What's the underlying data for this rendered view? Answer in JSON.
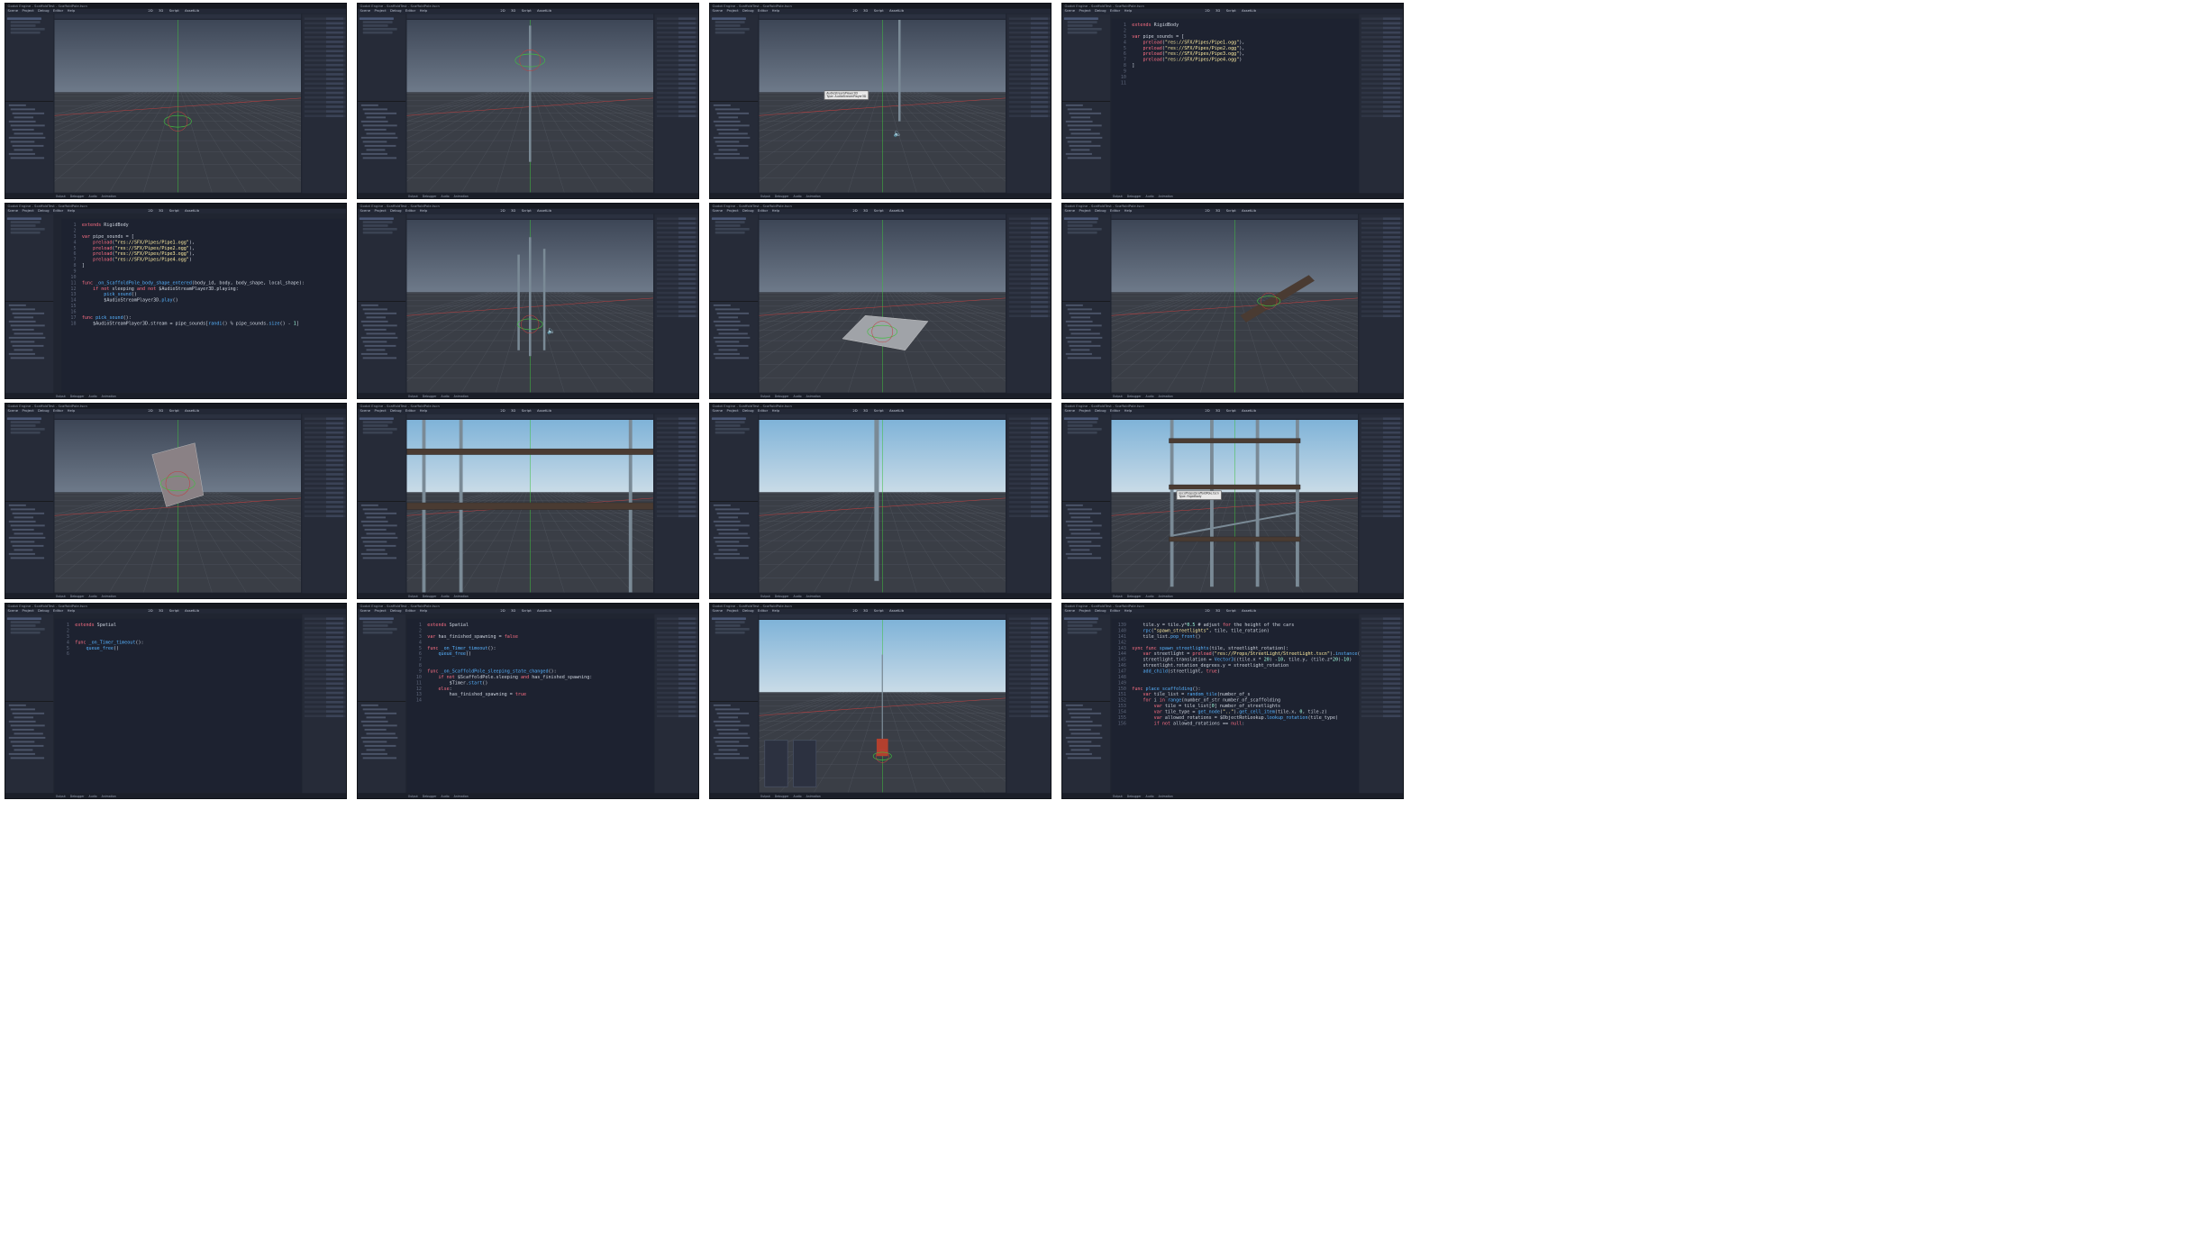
{
  "window": {
    "title": "Godot Engine - ScaffoldTest - ScaffoldPole.tscn",
    "menu": [
      "Scene",
      "Project",
      "Debug",
      "Editor",
      "Help"
    ],
    "workspaces": [
      "2D",
      "3D",
      "Script",
      "AssetLib"
    ],
    "bottom_tabs": [
      "Output",
      "Debugger",
      "Audio",
      "Animation"
    ]
  },
  "panels": [
    {
      "type": "viewport",
      "variant": "gizmo-ring"
    },
    {
      "type": "viewport",
      "variant": "pole-gizmo"
    },
    {
      "type": "viewport",
      "variant": "pole-speaker",
      "tooltip": "AudioStreamPlayer3D\nType: AudioStreamPlayer3D"
    },
    {
      "type": "code",
      "start": 1,
      "lines": [
        "extends RigidBody",
        "",
        "var pipe_sounds = [",
        "\tpreload(\"res://SFX/Pipes/Pipe1.ogg\"),",
        "\tpreload(\"res://SFX/Pipes/Pipe2.ogg\"),",
        "\tpreload(\"res://SFX/Pipes/Pipe3.ogg\"),",
        "\tpreload(\"res://SFX/Pipes/Pipe4.ogg\")",
        "]",
        "",
        "",
        ""
      ]
    },
    {
      "type": "code",
      "start": 1,
      "wide": true,
      "lines": [
        "extends RigidBody",
        "",
        "var pipe_sounds = [",
        "\tpreload(\"res://SFX/Pipes/Pipe1.ogg\"),",
        "\tpreload(\"res://SFX/Pipes/Pipe2.ogg\"),",
        "\tpreload(\"res://SFX/Pipes/Pipe3.ogg\"),",
        "\tpreload(\"res://SFX/Pipes/Pipe4.ogg\")",
        "]",
        "",
        "",
        "func _on_ScaffoldPole_body_shape_entered(body_id, body, body_shape, local_shape):",
        "\tif not sleeping and not $AudioStreamPlayer3D.playing:",
        "\t\tpick_sound()",
        "\t\t$AudioStreamPlayer3D.play()",
        "",
        "",
        "func pick_sound():",
        "\t$AudioStreamPlayer3D.stream = pipe_sounds[randi() % pipe_sounds.size() - 1]"
      ]
    },
    {
      "type": "viewport",
      "variant": "three-poles"
    },
    {
      "type": "viewport",
      "variant": "plank"
    },
    {
      "type": "viewport",
      "variant": "plank-angled"
    },
    {
      "type": "viewport",
      "variant": "cube"
    },
    {
      "type": "viewport",
      "variant": "shelves",
      "sky": "bright"
    },
    {
      "type": "viewport",
      "variant": "single-pole",
      "sky": "bright"
    },
    {
      "type": "viewport",
      "variant": "scaffold-tower",
      "sky": "bright",
      "tooltip": "res://Props/ScaffoldPole.tscn\nType: RigidBody"
    },
    {
      "type": "code",
      "start": 1,
      "lines": [
        "extends Spatial",
        "",
        "",
        "func _on_Timer_timeout():",
        "\tqueue_free()",
        ""
      ]
    },
    {
      "type": "code",
      "start": 1,
      "lines": [
        "extends Spatial",
        "",
        "var has_finished_spawning = false",
        "",
        "func _on_Timer_timeout():",
        "\tqueue_free()",
        "",
        "",
        "func _on_ScaffoldPole_sleeping_state_changed():",
        "\tif not $ScaffoldPole.sleeping and has_finished_spawning:",
        "\t\t$Timer.start()",
        "\telse:",
        "\t\thas_finished_spawning = true",
        ""
      ]
    },
    {
      "type": "viewport",
      "variant": "audio-bus",
      "sky": "bright"
    },
    {
      "type": "code",
      "start": 139,
      "lines": [
        "\ttile.y = tile.y*0.5 # adjust for the height of the cars",
        "\trpc(\"spawn_streetlights\", tile, tile_rotation)",
        "\ttile_list.pop_front()",
        "",
        "sync func spawn_streetlights(tile, streetlight_rotation):",
        "\tvar streetlight = preload(\"res://Props/StreetLight/StreetLight.tscn\").instance()",
        "\tstreetlight.translation = Vector3((tile.x * 20) -10, tile.y, (tile.z*20)-10)",
        "\tstreetlight.rotation_degrees.y = streetlight_rotation",
        "\tadd_child(streetlight, true)",
        "",
        "",
        "func place_scaffolding():",
        "\tvar tile_list = random_tile(number_of_s",
        "\tfor i in range(number_of_str number_of_scaffolding",
        "\t\tvar tile = tile_list[0] number_of_streetlights",
        "\t\tvar tile_type = get_node(\"..\").get_cell_item(tile.x, 0, tile.z)",
        "\t\tvar allowed_rotations = $ObjectRotLookup.lookup_rotation(tile_type)",
        "\t\tif not allowed_rotations == null:",
        "\t\t\tvar tile_rotation = allowed_rotations[randi() % allowed_rotations.size() -1] *-1",
        "\t\t\ttile.y = tile.y*0.5 # adjust for the height of the cars",
        "\t\t\trpc(\"spawn_streetlights\", tile, tile_rotation)",
        "\t\ttile_list.pop_front()",
        "",
        "sync func spawn_streetlights(tile, streetlight_rotation):",
        "\tvar streetlight = preload(\"res://Props/StreetLight/StreetLight.tscn\").instance()"
      ]
    }
  ],
  "colors": {
    "editor_bg": "#202531",
    "keyword": "#ff7085",
    "function": "#57b3ff",
    "string": "#ffeda1",
    "number": "#a1ffe0"
  }
}
